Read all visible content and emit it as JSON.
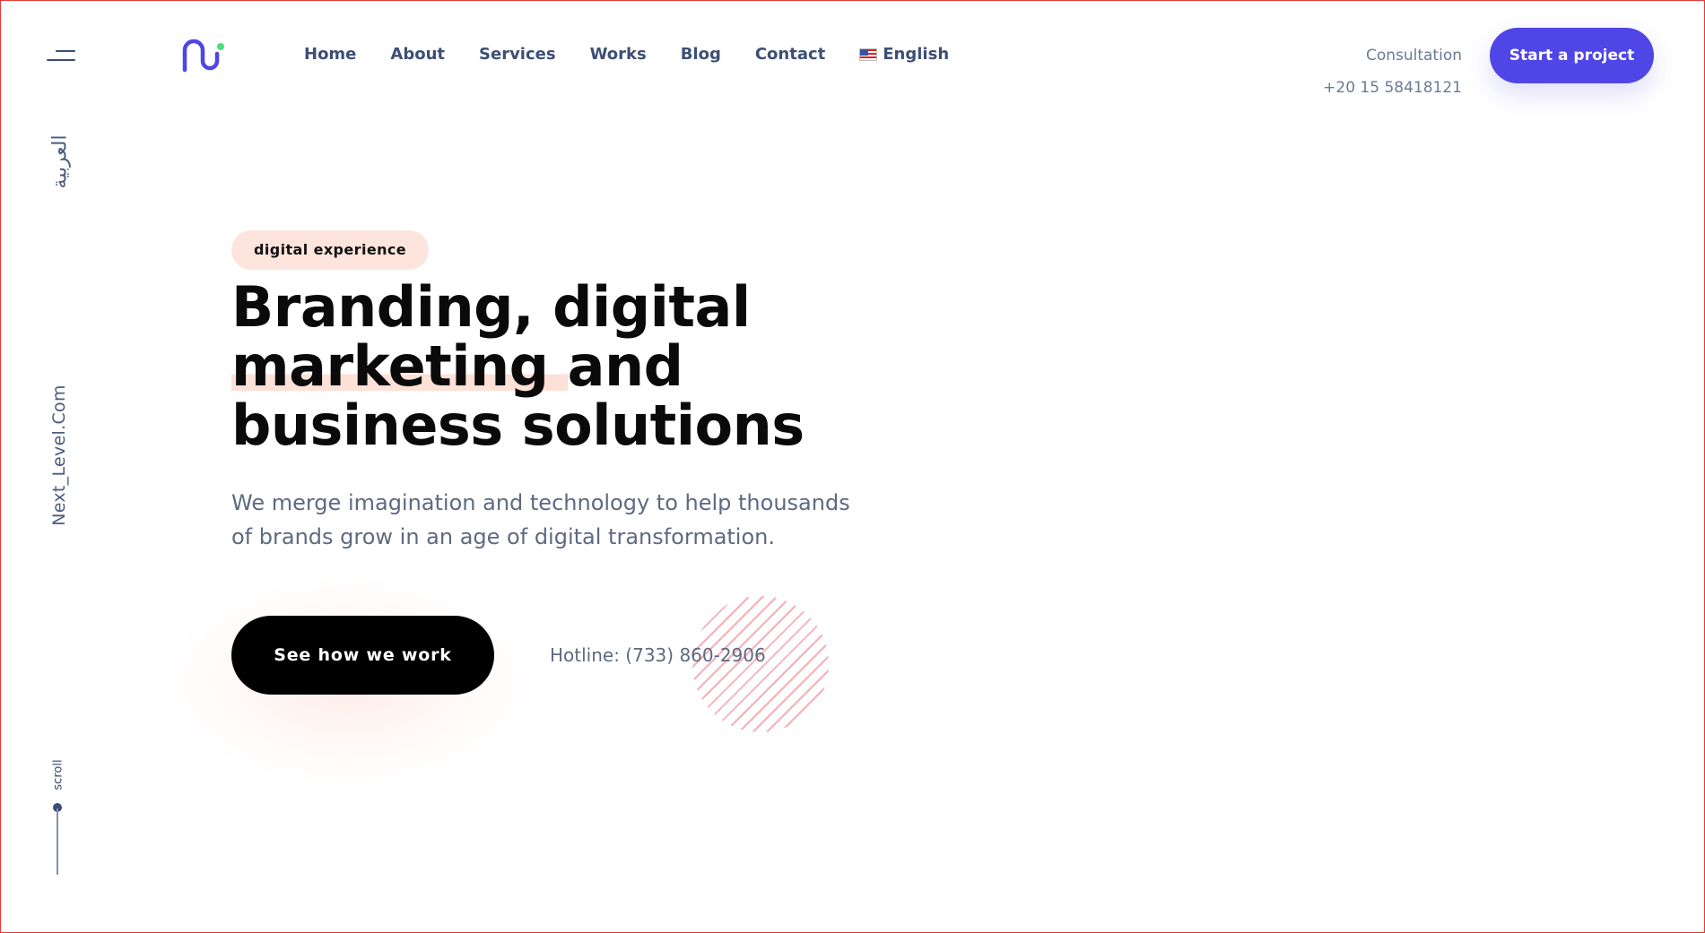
{
  "sidebar": {
    "menu_icon": "hamburger-menu-icon",
    "language_alt": "العربية",
    "brand": "Next_Level.Com",
    "scroll_label": "scroll"
  },
  "header": {
    "logo_icon": "brand-logo-icon",
    "nav": {
      "home": "Home",
      "about": "About",
      "services": "Services",
      "works": "Works",
      "blog": "Blog",
      "contact": "Contact",
      "language": "English",
      "language_flag_icon": "us-flag-icon"
    },
    "consultation_label": "Consultation",
    "consultation_phone": "+20 15 58418121",
    "cta": "Start a project"
  },
  "hero": {
    "pill": "digital experience",
    "headline_line1": "Branding, digital",
    "headline_highlight": "marketing",
    "headline_line2_rest": "and",
    "headline_line3": "business solutions",
    "subtitle": "We merge imagination and technology to help thousands of brands grow in an age of digital transformation.",
    "cta": "See how we work",
    "hotline": "Hotline: (733) 860-2906"
  },
  "colors": {
    "accent": "#4f46e5",
    "logo_dot": "#4ade80",
    "nav_text": "#3d4f74",
    "pill_bg": "#fde4dc",
    "stripe": "#f7a6b0"
  }
}
